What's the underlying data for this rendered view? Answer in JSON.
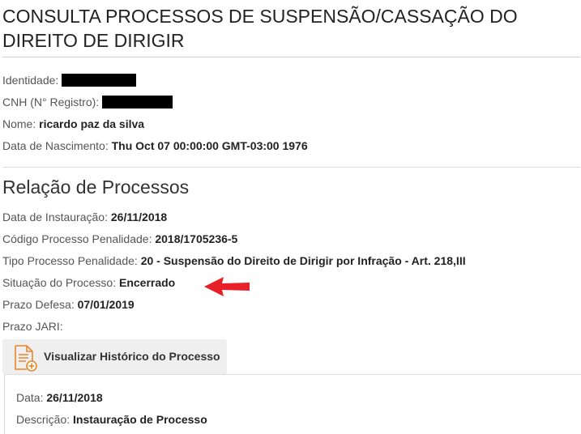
{
  "page": {
    "title": "CONSULTA PROCESSOS DE SUSPENSÃO/CASSAÇÃO DO DIREITO DE DIRIGIR"
  },
  "driver": {
    "identidade_label": "Identidade:",
    "cnh_label": "CNH (N° Registro):",
    "nome_label": "Nome:",
    "nome_value": "ricardo paz da silva",
    "nascimento_label": "Data de Nascimento:",
    "nascimento_value": "Thu Oct 07 00:00:00 GMT-03:00 1976"
  },
  "processos": {
    "section_title": "Relação de Processos",
    "data_instauracao_label": "Data de Instauração:",
    "data_instauracao_value": "26/11/2018",
    "codigo_label": "Código Processo Penalidade:",
    "codigo_value": "2018/1705236-5",
    "tipo_label": "Tipo Processo Penalidade:",
    "tipo_value": "20 - Suspensão do Direito de Dirigir por Infração - Art. 218,III",
    "situacao_label": "Situação do Processo:",
    "situacao_value": "Encerrado",
    "prazo_defesa_label": "Prazo Defesa:",
    "prazo_defesa_value": "07/01/2019",
    "prazo_jari_label": "Prazo JARI:",
    "historico_button_label": "Visualizar Histórico do Processo"
  },
  "historico": {
    "data_label": "Data:",
    "data_value": "26/11/2018",
    "descricao_label": "Descrição:",
    "descricao_value": "Instauração de Processo"
  },
  "colors": {
    "annotation_arrow": "#e8202a",
    "icon_accent": "#e8862a",
    "button_bg": "#efefef"
  },
  "icons": {
    "document_add": "document-add-icon",
    "annotation_arrow": "red-arrow-icon"
  }
}
